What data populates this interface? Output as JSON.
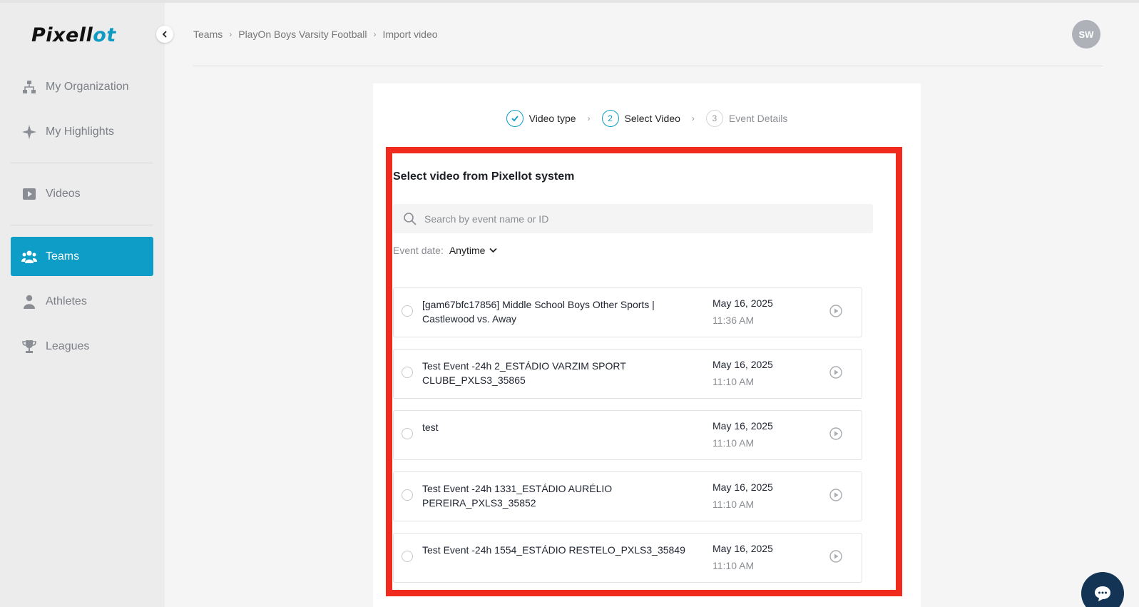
{
  "app": {
    "logo_text_a": "Pixell",
    "logo_text_b": "ot"
  },
  "sidebar": {
    "collapse_icon": "chevron-left-icon",
    "items": [
      {
        "label": "My Organization",
        "icon": "org-chart-icon",
        "active": false
      },
      {
        "label": "My Highlights",
        "icon": "sparkle-icon",
        "active": false
      },
      {
        "label": "Videos",
        "icon": "video-icon",
        "active": false
      },
      {
        "label": "Teams",
        "icon": "team-icon",
        "active": true
      },
      {
        "label": "Athletes",
        "icon": "athlete-icon",
        "active": false
      },
      {
        "label": "Leagues",
        "icon": "trophy-icon",
        "active": false
      }
    ]
  },
  "header": {
    "breadcrumb": [
      "Teams",
      "PlayOn Boys Varsity Football",
      "Import video"
    ],
    "avatar_initials": "SW"
  },
  "steps": [
    {
      "number": "✓",
      "label": "Video type",
      "state": "done"
    },
    {
      "number": "2",
      "label": "Select Video",
      "state": "current"
    },
    {
      "number": "3",
      "label": "Event Details",
      "state": "pending"
    }
  ],
  "main": {
    "title": "Select video from Pixellot system",
    "search_placeholder": "Search by event name or ID",
    "filter_label": "Event date:",
    "filter_value": "Anytime",
    "videos": [
      {
        "name": "[gam67bfc17856] Middle School Boys Other Sports | Castlewood vs. Away",
        "date": "May 16, 2025",
        "time": "11:36 AM"
      },
      {
        "name": "Test Event -24h 2_ESTÁDIO VARZIM SPORT CLUBE_PXLS3_35865",
        "date": "May 16, 2025",
        "time": "11:10 AM"
      },
      {
        "name": "test",
        "date": "May 16, 2025",
        "time": "11:10 AM"
      },
      {
        "name": "Test Event -24h 1331_ESTÁDIO AURÉLIO PEREIRA_PXLS3_35852",
        "date": "May 16, 2025",
        "time": "11:10 AM"
      },
      {
        "name": "Test Event -24h 1554_ESTÁDIO RESTELO_PXLS3_35849",
        "date": "May 16, 2025",
        "time": "11:10 AM"
      }
    ]
  },
  "colors": {
    "accent": "#0d9dc6",
    "highlight": "#f02a1d",
    "chat": "#133455"
  }
}
